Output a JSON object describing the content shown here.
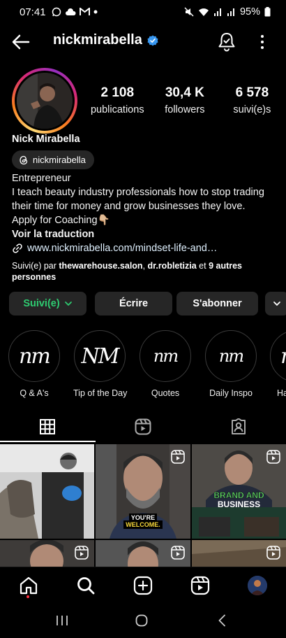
{
  "status_bar": {
    "time": "07:41",
    "battery": "95%"
  },
  "header": {
    "username": "nickmirabella"
  },
  "profile": {
    "stats": [
      {
        "value": "2 108",
        "label": "publications"
      },
      {
        "value": "30,4 K",
        "label": "followers"
      },
      {
        "value": "6 578",
        "label": "suivi(e)s"
      }
    ],
    "full_name": "Nick Mirabella",
    "threads_handle": "nickmirabella",
    "bio_lines": [
      "Entrepreneur",
      "I teach beauty industry professionals how to stop trading",
      "their time for money and grow businesses they love.",
      "Apply for Coaching👇🏼"
    ],
    "translate": "Voir la traduction",
    "link": "www.nickmirabella.com/mindset-life-and…",
    "followed_by_prefix": "Suivi(e) par ",
    "followed_by_user1": "thewarehouse.salon",
    "followed_by_sep": ", ",
    "followed_by_user2": "dr.robletizia",
    "followed_by_mid": " et ",
    "followed_by_rest": "9 autres personnes"
  },
  "actions": {
    "follow": "Suivi(e)",
    "message": "Écrire",
    "subscribe": "S'abonner"
  },
  "highlights": [
    {
      "label": "Q & A's",
      "mark": "nm"
    },
    {
      "label": "Tip of the Day",
      "mark": "NM"
    },
    {
      "label": "Quotes",
      "mark": "nm"
    },
    {
      "label": "Daily Inspo",
      "mark": "nm"
    },
    {
      "label": "Ha",
      "mark": "nm"
    }
  ],
  "grid_overlays": {
    "post2": "YOU'RE WELCOME.",
    "post3_line1": "BRAND AND",
    "post3_line2": "BUSINESS"
  },
  "colors": {
    "follow_green": "#2ecc71",
    "verified_blue": "#3897f0",
    "background": "#000000",
    "button_bg": "#262626"
  }
}
